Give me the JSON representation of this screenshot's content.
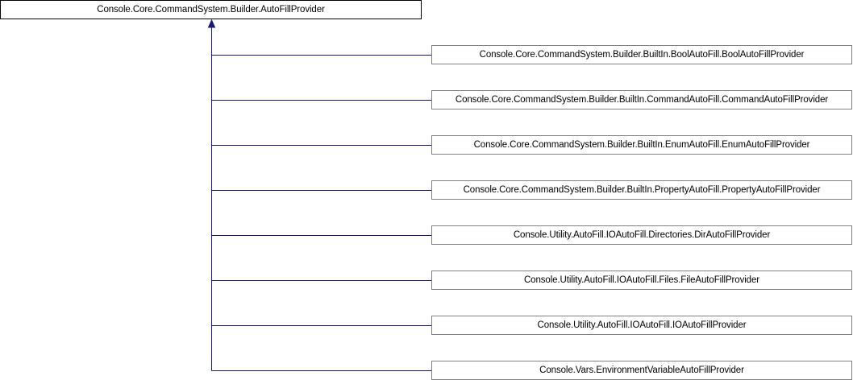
{
  "base_class": "Console.Core.CommandSystem.Builder.AutoFillProvider",
  "derived_classes": [
    "Console.Core.CommandSystem.Builder.BuiltIn.BoolAutoFill.BoolAutoFillProvider",
    "Console.Core.CommandSystem.Builder.BuiltIn.CommandAutoFill.CommandAutoFillProvider",
    "Console.Core.CommandSystem.Builder.BuiltIn.EnumAutoFill.EnumAutoFillProvider",
    "Console.Core.CommandSystem.Builder.BuiltIn.PropertyAutoFill.PropertyAutoFillProvider",
    "Console.Utility.AutoFill.IOAutoFill.Directories.DirAutoFillProvider",
    "Console.Utility.AutoFill.IOAutoFill.Files.FileAutoFillProvider",
    "Console.Utility.AutoFill.IOAutoFill.IOAutoFillProvider",
    "Console.Vars.EnvironmentVariableAutoFillProvider"
  ],
  "colors": {
    "connector": "#191970",
    "base_border": "#000000",
    "derived_border": "#808080"
  }
}
